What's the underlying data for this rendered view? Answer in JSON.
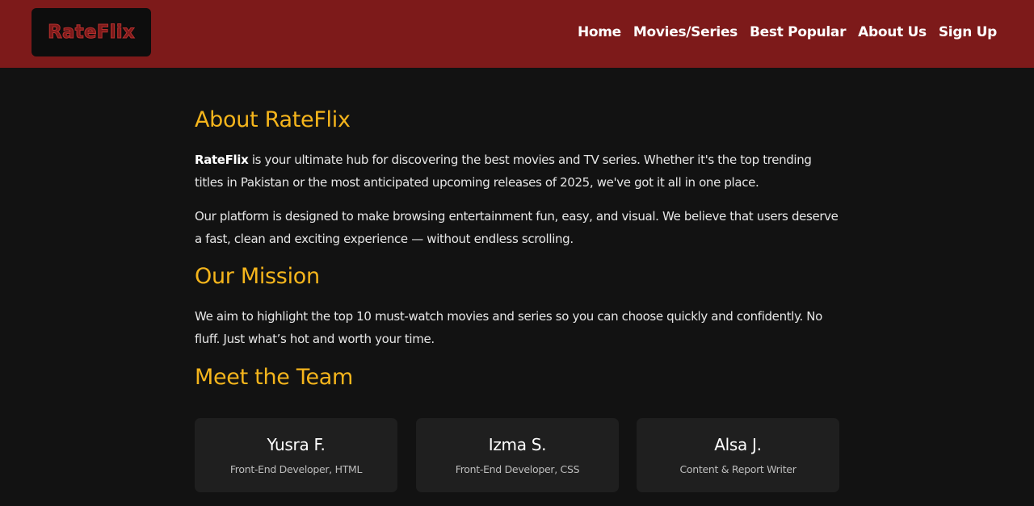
{
  "header": {
    "logo_text": "RateFlix",
    "nav": [
      {
        "label": "Home"
      },
      {
        "label": "Movies/Series"
      },
      {
        "label": "Best Popular"
      },
      {
        "label": "About Us"
      },
      {
        "label": "Sign Up"
      }
    ]
  },
  "about": {
    "title": "About RateFlix",
    "intro_brand": "RateFlix",
    "intro_rest": " is your ultimate hub for discovering the best movies and TV series. Whether it's the top trending titles in Pakistan or the most anticipated upcoming releases of 2025, we've got it all in one place.",
    "paragraph2": "Our platform is designed to make browsing entertainment fun, easy, and visual. We believe that users deserve a fast, clean and exciting experience — without endless scrolling."
  },
  "mission": {
    "title": "Our Mission",
    "text": "We aim to highlight the top 10 must-watch movies and series so you can choose quickly and confidently. No fluff. Just what’s hot and worth your time."
  },
  "team": {
    "title": "Meet the Team",
    "members": [
      {
        "name": "Yusra F.",
        "role": "Front-End Developer, HTML"
      },
      {
        "name": "Izma S.",
        "role": "Front-End Developer, CSS"
      },
      {
        "name": "Alsa J.",
        "role": "Content & Report Writer"
      }
    ]
  },
  "colors": {
    "header_bg": "#7d1a1a",
    "page_bg": "#121212",
    "accent": "#f5b51c",
    "card_bg": "#1f1f1f"
  }
}
